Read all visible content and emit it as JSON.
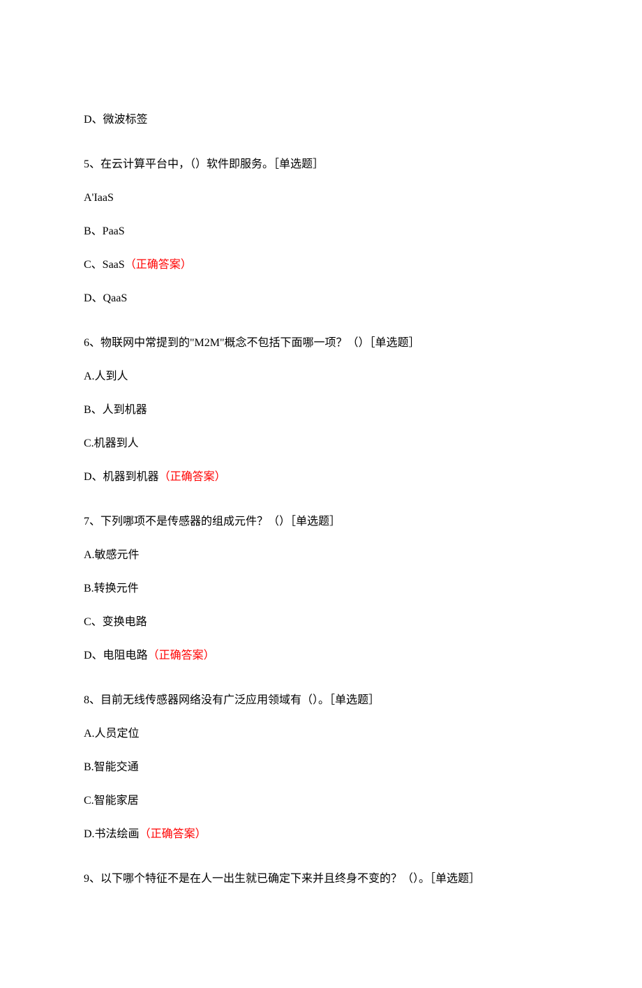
{
  "correctLabel": "（正确答案）",
  "q4": {
    "optD": "D、微波标签"
  },
  "q5": {
    "stem": "5、在云计算平台中，（）软件即服务。［单选题］",
    "optA": "A'IaaS",
    "optB": "B、PaaS",
    "optC": "C、SaaS",
    "optD": "D、QaaS"
  },
  "q6": {
    "stem": "6、物联网中常提到的\"M2M\"概念不包括下面哪一项？（）［单选题］",
    "optA": "A.人到人",
    "optB": "B、人到机器",
    "optC": "C.机器到人",
    "optD": "D、机器到机器"
  },
  "q7": {
    "stem": "7、下列哪项不是传感器的组成元件？（）［单选题］",
    "optA": "A.敏感元件",
    "optB": "B.转换元件",
    "optC": "C、变换电路",
    "optD": "D、电阻电路"
  },
  "q8": {
    "stem": "8、目前无线传感器网络没有广泛应用领域有（）。［单选题］",
    "optA": "A.人员定位",
    "optB": "B.智能交通",
    "optC": "C.智能家居",
    "optD": "D.书法绘画"
  },
  "q9": {
    "stem": "9、以下哪个特征不是在人一出生就已确定下来并且终身不变的？（）。［单选题］"
  }
}
